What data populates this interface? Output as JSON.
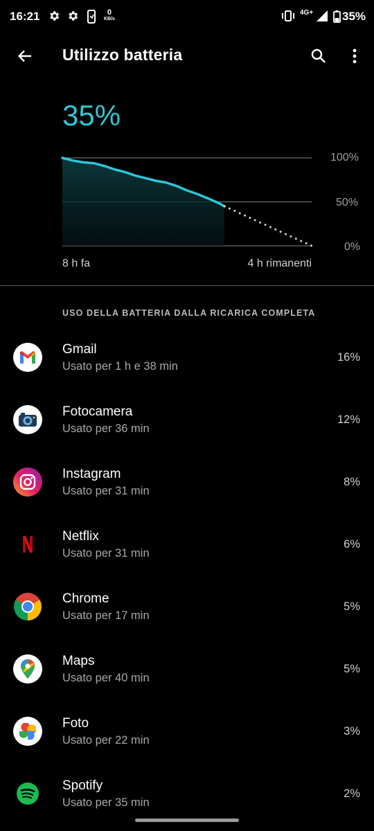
{
  "status_bar": {
    "time": "16:21",
    "net_speed_value": "0",
    "net_speed_unit": "KB/s",
    "network_type": "4G+",
    "battery_percent": "35%"
  },
  "app_bar": {
    "title": "Utilizzo batteria",
    "back_icon": "arrow-left-icon",
    "search_icon": "search-icon",
    "more_icon": "more-vert-icon"
  },
  "summary": {
    "battery_level": "35%",
    "time_start_label": "8 h fa",
    "time_end_label": "4 h rimanenti"
  },
  "chart_data": {
    "type": "line",
    "y_tick_labels": [
      "100%",
      "50%",
      "0%"
    ],
    "ylim": [
      0,
      100
    ],
    "x_range_hours": [
      0,
      12
    ],
    "series": [
      {
        "style": "solid",
        "x": [
          0,
          0.5,
          1.0,
          1.5,
          2.0,
          2.5,
          3.0,
          3.5,
          4.0,
          4.5,
          5.0,
          5.5,
          6.0,
          6.5,
          7.0,
          7.5,
          7.8
        ],
        "y": [
          100,
          97,
          95,
          94,
          91,
          87,
          84,
          80,
          77,
          74,
          72,
          68,
          63,
          59,
          54,
          49,
          45
        ]
      },
      {
        "style": "dotted",
        "x": [
          7.8,
          12
        ],
        "y": [
          45,
          0
        ]
      }
    ],
    "colors": {
      "line": "#2ec7d6",
      "grid": "#6b6b6b",
      "fill": "#0b3b3e"
    }
  },
  "section": {
    "header": "USO DELLA BATTERIA DALLA RICARICA COMPLETA"
  },
  "apps": [
    {
      "name": "Gmail",
      "usage": "Usato per 1 h e 38 min",
      "percent": "16%",
      "icon": "gmail-icon"
    },
    {
      "name": "Fotocamera",
      "usage": "Usato per 36 min",
      "percent": "12%",
      "icon": "camera-icon"
    },
    {
      "name": "Instagram",
      "usage": "Usato per 31 min",
      "percent": "8%",
      "icon": "instagram-icon"
    },
    {
      "name": "Netflix",
      "usage": "Usato per 31 min",
      "percent": "6%",
      "icon": "netflix-icon"
    },
    {
      "name": "Chrome",
      "usage": "Usato per 17 min",
      "percent": "5%",
      "icon": "chrome-icon"
    },
    {
      "name": "Maps",
      "usage": "Usato per 40 min",
      "percent": "5%",
      "icon": "maps-icon"
    },
    {
      "name": "Foto",
      "usage": "Usato per 22 min",
      "percent": "3%",
      "icon": "photos-icon"
    },
    {
      "name": "Spotify",
      "usage": "Usato per 35 min",
      "percent": "2%",
      "icon": "spotify-icon"
    }
  ]
}
